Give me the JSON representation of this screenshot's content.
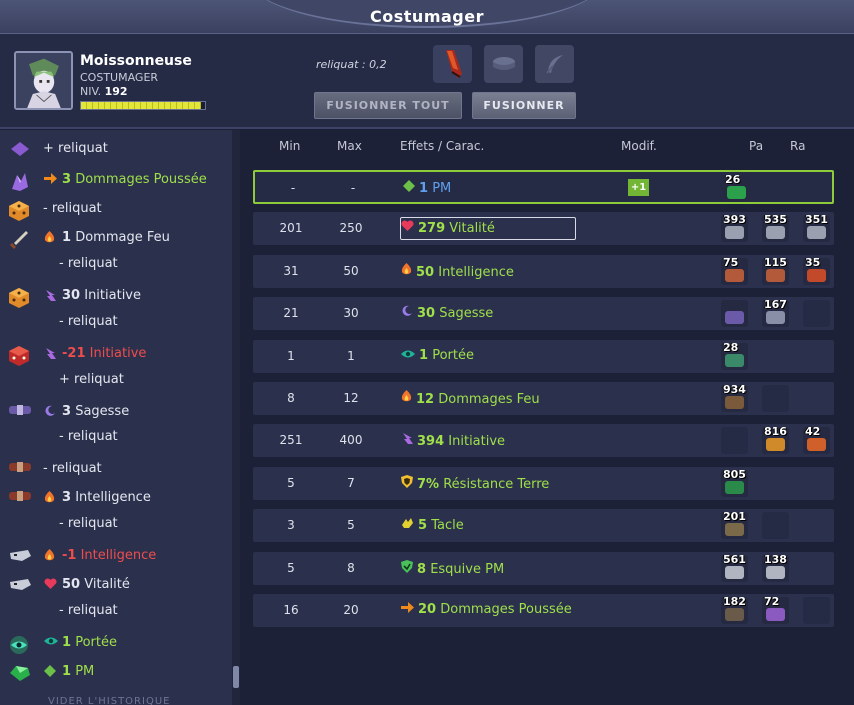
{
  "window": {
    "title": "Costumager"
  },
  "player": {
    "name": "Moissonneuse",
    "class": "COSTUMAGER",
    "level_label": "NIV.",
    "level": "192",
    "xp_fraction": 0.97
  },
  "header": {
    "reliquat": "reliquat : 0,2",
    "fuse_all_label": "FUSIONNER TOUT",
    "fuse_label": "FUSIONNER"
  },
  "colors": {
    "positive": "#9fe04a",
    "negative": "#ef4d4d",
    "selected_border": "#8ecb3b"
  },
  "left_list": [
    {
      "icon": "purple-gem-icon",
      "effect_icon": "",
      "value": "",
      "label": "+ reliquat",
      "color": "normal"
    },
    {
      "icon": "purple-crystal-icon",
      "effect_icon": "push-arrow-icon",
      "value": "3",
      "label": "Dommages Poussée",
      "color": "positive"
    },
    {
      "icon": "orange-dice-icon",
      "effect_icon": "",
      "value": "",
      "label": "- reliquat",
      "color": "normal"
    },
    {
      "icon": "sword-icon",
      "effect_icon": "fire-icon",
      "value": "1",
      "label": "Dommage Feu",
      "color": "normal"
    },
    {
      "icon": "",
      "effect_icon": "",
      "value": "",
      "label": "- reliquat",
      "color": "normal"
    },
    {
      "icon": "orange-dice-icon",
      "effect_icon": "initiative-icon",
      "value": "30",
      "label": "Initiative",
      "color": "normal"
    },
    {
      "icon": "",
      "effect_icon": "",
      "value": "",
      "label": "- reliquat",
      "color": "normal"
    },
    {
      "icon": "red-dice-icon",
      "effect_icon": "initiative-icon",
      "value": "-21",
      "label": "Initiative",
      "color": "negative"
    },
    {
      "icon": "",
      "effect_icon": "",
      "value": "",
      "label": "+ reliquat",
      "color": "normal"
    },
    {
      "icon": "belt-purple-icon",
      "effect_icon": "moon-icon",
      "value": "3",
      "label": "Sagesse",
      "color": "normal"
    },
    {
      "icon": "",
      "effect_icon": "",
      "value": "",
      "label": "- reliquat",
      "color": "normal"
    },
    {
      "icon": "belt-red-icon",
      "effect_icon": "",
      "value": "",
      "label": "- reliquat",
      "color": "normal"
    },
    {
      "icon": "belt-red-icon",
      "effect_icon": "fire-icon",
      "value": "3",
      "label": "Intelligence",
      "color": "normal"
    },
    {
      "icon": "",
      "effect_icon": "",
      "value": "",
      "label": "- reliquat",
      "color": "normal"
    },
    {
      "icon": "wolf-skull-icon",
      "effect_icon": "fire-icon",
      "value": "-1",
      "label": "Intelligence",
      "color": "negative"
    },
    {
      "icon": "wolf-skull-icon",
      "effect_icon": "heart-icon",
      "value": "50",
      "label": "Vitalité",
      "color": "normal"
    },
    {
      "icon": "",
      "effect_icon": "",
      "value": "",
      "label": "- reliquat",
      "color": "normal"
    },
    {
      "icon": "green-eye-stone-icon",
      "effect_icon": "eye-icon",
      "value": "1",
      "label": "Portée",
      "color": "positive"
    },
    {
      "icon": "green-gem-icon",
      "effect_icon": "diamond-icon",
      "value": "1",
      "label": "PM",
      "color": "positive"
    }
  ],
  "left_footer": "VIDER L'HISTORIQUE",
  "table": {
    "headers": {
      "min": "Min",
      "max": "Max",
      "effects": "Effets / Carac.",
      "modif": "Modif.",
      "pa": "Pa",
      "ra": "Ra"
    },
    "rows": [
      {
        "min": "-",
        "max": "-",
        "effect_icon": "diamond-icon",
        "value": "1",
        "label": "PM",
        "value_color": "#5fa0ee",
        "modif": "+1",
        "selected": true,
        "boxed": false,
        "runes": [
          {
            "count": "26",
            "color": "#2aa14a"
          },
          {
            "count": "",
            "color": ""
          },
          {
            "count": "",
            "color": ""
          }
        ]
      },
      {
        "min": "201",
        "max": "250",
        "effect_icon": "heart-icon",
        "value": "279",
        "label": "Vitalité",
        "value_color": "#9fe04a",
        "modif": "",
        "selected": false,
        "boxed": true,
        "runes": [
          {
            "count": "393",
            "color": "#9aa0b0"
          },
          {
            "count": "535",
            "color": "#9aa0b0"
          },
          {
            "count": "351",
            "color": "#9aa0b0"
          }
        ]
      },
      {
        "min": "31",
        "max": "50",
        "effect_icon": "fire-icon",
        "value": "50",
        "label": "Intelligence",
        "value_color": "#9fe04a",
        "modif": "",
        "selected": false,
        "boxed": false,
        "runes": [
          {
            "count": "75",
            "color": "#b25a3a"
          },
          {
            "count": "115",
            "color": "#b25a3a"
          },
          {
            "count": "35",
            "color": "#c24a2a"
          }
        ]
      },
      {
        "min": "21",
        "max": "30",
        "effect_icon": "moon-icon",
        "value": "30",
        "label": "Sagesse",
        "value_color": "#9fe04a",
        "modif": "",
        "selected": false,
        "boxed": false,
        "runes": [
          {
            "count": "",
            "color": "#6a5aa8"
          },
          {
            "count": "167",
            "color": "#8a8fa8"
          },
          {
            "count": "",
            "color": "empty"
          }
        ]
      },
      {
        "min": "1",
        "max": "1",
        "effect_icon": "eye-icon",
        "value": "1",
        "label": "Portée",
        "value_color": "#9fe04a",
        "modif": "",
        "selected": false,
        "boxed": false,
        "runes": [
          {
            "count": "28",
            "color": "#3a8a6a"
          },
          {
            "count": "",
            "color": ""
          },
          {
            "count": "",
            "color": ""
          }
        ]
      },
      {
        "min": "8",
        "max": "12",
        "effect_icon": "fire-icon",
        "value": "12",
        "label": "Dommages Feu",
        "value_color": "#9fe04a",
        "modif": "",
        "selected": false,
        "boxed": false,
        "runes": [
          {
            "count": "934",
            "color": "#7a5a3a"
          },
          {
            "count": "",
            "color": "empty"
          },
          {
            "count": "",
            "color": ""
          }
        ]
      },
      {
        "min": "251",
        "max": "400",
        "effect_icon": "initiative-icon",
        "value": "394",
        "label": "Initiative",
        "value_color": "#9fe04a",
        "modif": "",
        "selected": false,
        "boxed": false,
        "runes": [
          {
            "count": "",
            "color": "empty"
          },
          {
            "count": "816",
            "color": "#d08a2a"
          },
          {
            "count": "42",
            "color": "#d0602a"
          }
        ]
      },
      {
        "min": "5",
        "max": "7",
        "effect_icon": "shield-earth-icon",
        "value": "7%",
        "label": "Résistance Terre",
        "value_color": "#9fe04a",
        "modif": "",
        "selected": false,
        "boxed": false,
        "runes": [
          {
            "count": "805",
            "color": "#2a8a4a"
          },
          {
            "count": "",
            "color": ""
          },
          {
            "count": "",
            "color": ""
          }
        ]
      },
      {
        "min": "3",
        "max": "5",
        "effect_icon": "tackle-icon",
        "value": "5",
        "label": "Tacle",
        "value_color": "#9fe04a",
        "modif": "",
        "selected": false,
        "boxed": false,
        "runes": [
          {
            "count": "201",
            "color": "#7a6a4a"
          },
          {
            "count": "",
            "color": "empty"
          },
          {
            "count": "",
            "color": ""
          }
        ]
      },
      {
        "min": "5",
        "max": "8",
        "effect_icon": "dodge-shield-icon",
        "value": "8",
        "label": "Esquive PM",
        "value_color": "#9fe04a",
        "modif": "",
        "selected": false,
        "boxed": false,
        "runes": [
          {
            "count": "561",
            "color": "#b0b4c0"
          },
          {
            "count": "138",
            "color": "#b0b4c0"
          },
          {
            "count": "",
            "color": ""
          }
        ]
      },
      {
        "min": "16",
        "max": "20",
        "effect_icon": "push-arrow-icon",
        "value": "20",
        "label": "Dommages Poussée",
        "value_color": "#9fe04a",
        "modif": "",
        "selected": false,
        "boxed": false,
        "runes": [
          {
            "count": "182",
            "color": "#6a5a4a"
          },
          {
            "count": "72",
            "color": "#8a5ac0"
          },
          {
            "count": "",
            "color": "empty"
          }
        ]
      }
    ]
  }
}
